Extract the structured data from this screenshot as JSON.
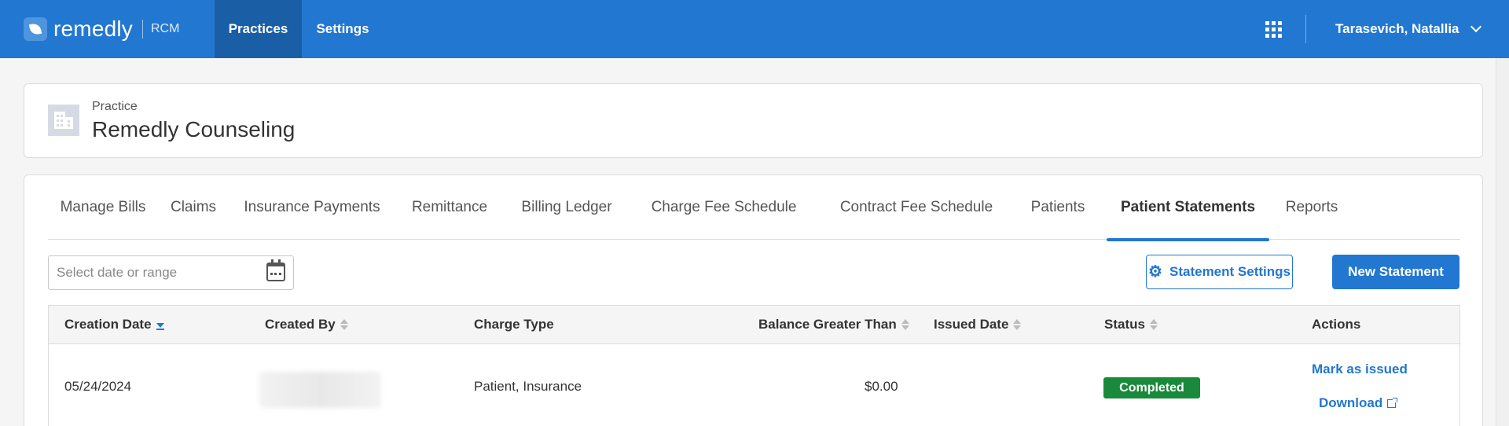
{
  "topbar": {
    "logo_word": "remedly",
    "logo_sub": "RCM",
    "nav": [
      {
        "label": "Practices"
      },
      {
        "label": "Settings"
      }
    ],
    "user_name": "Tarasevich, Natallia"
  },
  "practice": {
    "label": "Practice",
    "name": "Remedly Counseling"
  },
  "tabs": [
    {
      "label": "Manage Bills"
    },
    {
      "label": "Claims"
    },
    {
      "label": "Insurance Payments"
    },
    {
      "label": "Remittance"
    },
    {
      "label": "Billing Ledger"
    },
    {
      "label": "Charge Fee Schedule"
    },
    {
      "label": "Contract Fee Schedule"
    },
    {
      "label": "Patients"
    },
    {
      "label": "Patient Statements"
    },
    {
      "label": "Reports"
    }
  ],
  "filters": {
    "date_placeholder": "Select date or range"
  },
  "buttons": {
    "statement_settings": "Statement Settings",
    "new_statement": "New Statement"
  },
  "table": {
    "columns": [
      "Creation Date",
      "Created By",
      "Charge Type",
      "Balance Greater Than",
      "Issued Date",
      "Status",
      "Actions"
    ],
    "rows": [
      {
        "creation_date": "05/24/2024",
        "charge_type": "Patient, Insurance",
        "balance": "$0.00",
        "status": "Completed",
        "action_1": "Mark as issued",
        "action_2": "Download"
      }
    ]
  },
  "colors": {
    "brand": "#2277d1",
    "nav_active": "#1a5fa6",
    "status_completed": "#198a3c"
  }
}
